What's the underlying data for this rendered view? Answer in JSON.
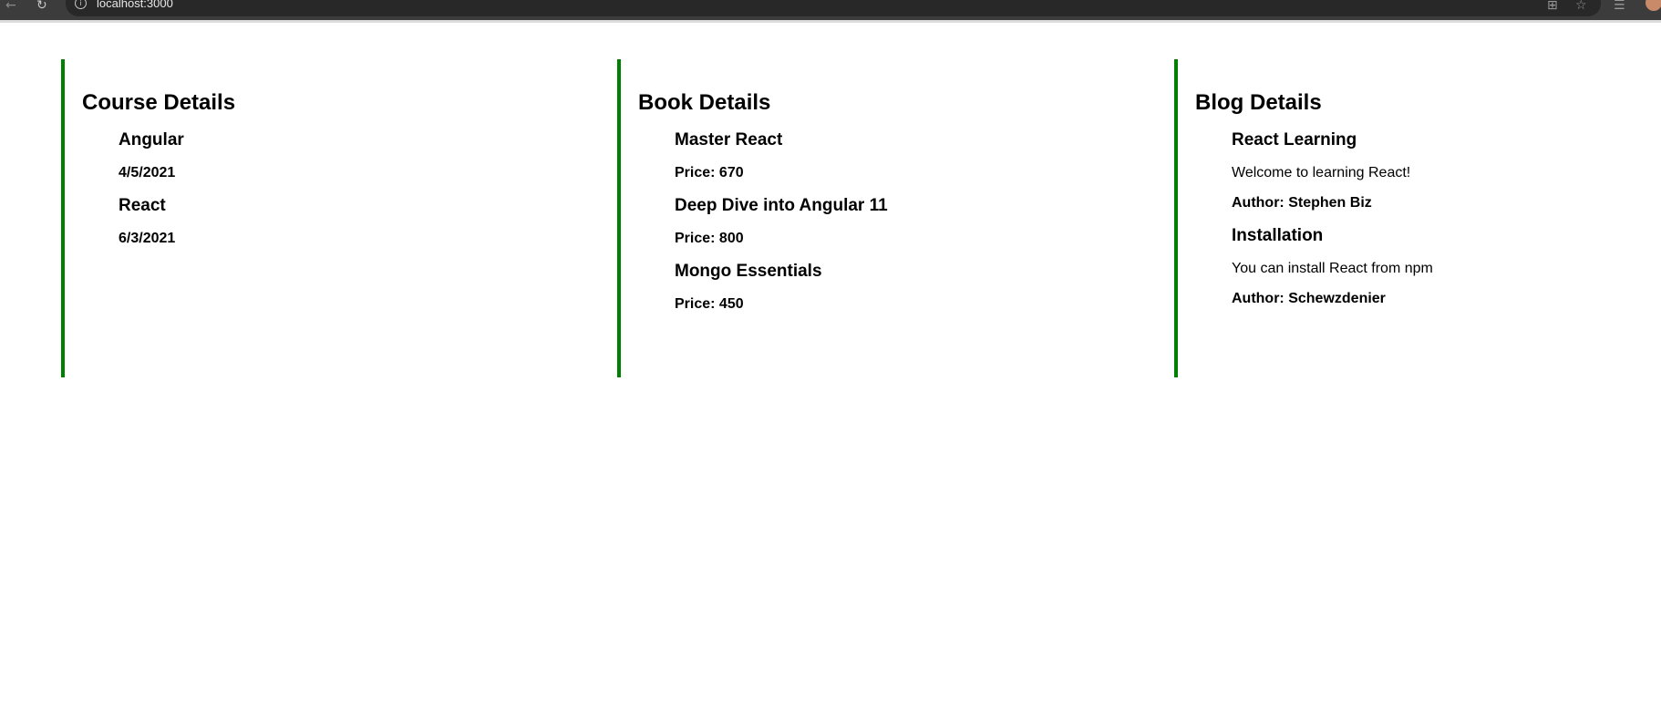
{
  "browser": {
    "url": "localhost:3000",
    "icons": {
      "back": "arrow-left-icon",
      "reload": "reload-icon",
      "info": "info-icon",
      "apps": "grid-icon",
      "star": "star-icon",
      "lists": "reading-list-icon",
      "profile": "avatar"
    },
    "glyphs": {
      "back": "←",
      "reload": "↻",
      "info": "i",
      "apps": "⊞",
      "star": "☆",
      "lists": "☰"
    }
  },
  "colors": {
    "accent_border": "#008000"
  },
  "course": {
    "title": "Course Details",
    "items": [
      {
        "name": "Angular",
        "date": "4/5/2021"
      },
      {
        "name": "React",
        "date": "6/3/2021"
      }
    ]
  },
  "book": {
    "title": "Book Details",
    "items": [
      {
        "name": "Master React",
        "price": "Price: 670"
      },
      {
        "name": "Deep Dive into Angular 11",
        "price": "Price: 800"
      },
      {
        "name": "Mongo Essentials",
        "price": "Price: 450"
      }
    ]
  },
  "blog": {
    "title": "Blog Details",
    "items": [
      {
        "title": "React Learning",
        "content": "Welcome to learning React!",
        "author": "Author: Stephen Biz"
      },
      {
        "title": "Installation",
        "content": "You can install React from npm",
        "author": "Author: Schewzdenier"
      }
    ]
  }
}
